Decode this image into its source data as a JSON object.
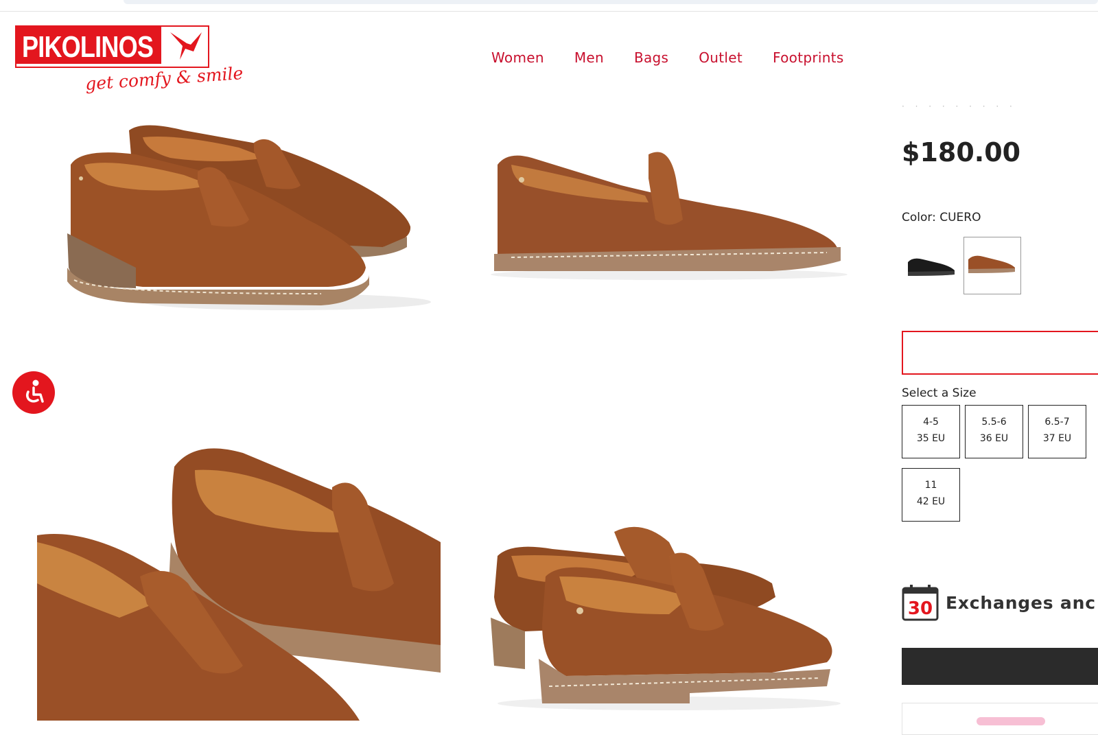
{
  "brand": {
    "name": "PIKOLINOS",
    "tagline": "get comfy & smile",
    "color": "#e3161e"
  },
  "nav": {
    "items": [
      {
        "label": "Women"
      },
      {
        "label": "Men"
      },
      {
        "label": "Bags"
      },
      {
        "label": "Outlet"
      },
      {
        "label": "Footprints"
      }
    ]
  },
  "product": {
    "price": "$180.00",
    "color_label": "Color:",
    "color_value": "CUERO",
    "swatches": [
      {
        "name": "black",
        "icon": "black-loafer-thumbnail",
        "selected": false
      },
      {
        "name": "CUERO",
        "icon": "brown-loafer-thumbnail",
        "selected": true
      }
    ],
    "select_size_label": "Select a Size",
    "sizes": [
      {
        "us": "4-5",
        "eu": "35 EU"
      },
      {
        "us": "5.5-6",
        "eu": "36 EU"
      },
      {
        "us": "6.5-7",
        "eu": "37 EU"
      },
      {
        "us": "11",
        "eu": "42 EU"
      }
    ],
    "exchanges_number": "30",
    "exchanges_text": "Exchanges anc"
  },
  "accessibility": {
    "icon": "accessibility-icon"
  }
}
